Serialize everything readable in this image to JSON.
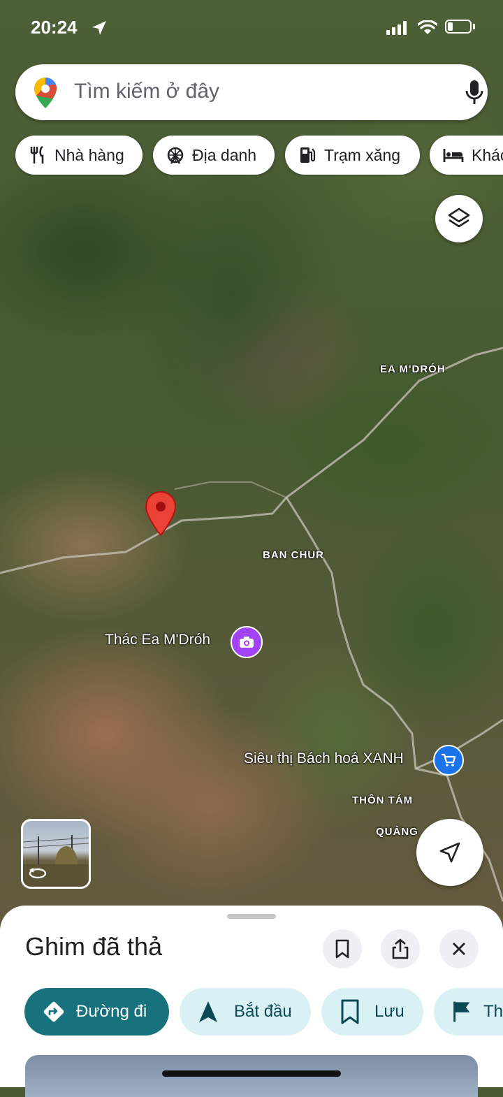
{
  "status_bar": {
    "time": "20:24"
  },
  "search": {
    "placeholder": "Tìm kiếm ở đây"
  },
  "chips": [
    {
      "label": "Nhà hàng",
      "icon": "restaurant-icon"
    },
    {
      "label": "Địa danh",
      "icon": "landmark-icon"
    },
    {
      "label": "Trạm xăng",
      "icon": "gas-station-icon"
    },
    {
      "label": "Khác",
      "icon": "hotel-icon"
    }
  ],
  "map_labels": {
    "ea_mdroh": "EA M'DRÓH",
    "ban_chur": "BAN CHUR",
    "thon_tam": "THÔN TÁM",
    "quang": "QUẢNG"
  },
  "pois": {
    "waterfall": {
      "name": "Thác Ea M'Dróh",
      "icon": "camera-icon",
      "color": "#a142f4"
    },
    "store": {
      "name": "Siêu thị Bách hoá XANH",
      "icon": "shopping-cart-icon",
      "color": "#1a73e8"
    }
  },
  "pin": {
    "color": "#ea4335"
  },
  "sheet": {
    "title": "Ghim đã thả",
    "actions": [
      {
        "label": "Đường đi",
        "icon": "directions-icon"
      },
      {
        "label": "Bắt đầu",
        "icon": "navigation-arrow-icon"
      },
      {
        "label": "Lưu",
        "icon": "bookmark-icon"
      },
      {
        "label": "Th",
        "icon": "flag-icon"
      }
    ]
  },
  "colors": {
    "primary": "#17727e",
    "secondary": "#d9f1f5"
  }
}
